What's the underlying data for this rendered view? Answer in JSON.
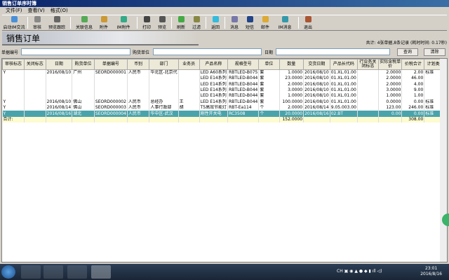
{
  "window": {
    "title": "销售订单序时簿"
  },
  "menu": [
    "文件(F)",
    "查看(V)",
    "格式(O)"
  ],
  "toolbar": [
    "启动IM交流",
    "审核",
    "预览跟踪",
    "关联信息",
    "附件",
    "IM附件",
    "打印",
    "预览",
    "刷新",
    "过滤",
    "返回",
    "消息",
    "短信",
    "邮件",
    "IM消息",
    "退出"
  ],
  "banner": {
    "title": "销售订单"
  },
  "summary": "共计: 4张单据,8条记录 (耗时时间: 0.17秒)",
  "filter": {
    "bill_no_label": "单据编号",
    "bill_no_value": "",
    "customer_label": "购货单位",
    "customer_value": "",
    "date_label": "日期",
    "date_value": "",
    "search": "查询",
    "clear": "清除"
  },
  "table": {
    "columns": [
      "审核标志",
      "关闭标志",
      "日期",
      "购货单位",
      "单据编号",
      "币别",
      "部门",
      "业务员",
      "产品名称",
      "规格型号",
      "单位",
      "数量",
      "交货日期",
      "产品长代码",
      "行业务关闭标志",
      "实际含税单价",
      "价税合计",
      "计划类别"
    ],
    "rows": [
      [
        "Y",
        "",
        "2016/08/10",
        "广州",
        "SEORD000001",
        "人民币",
        "华北区-北京代",
        "",
        "LED A60系列",
        "RBTLED-B075",
        "套",
        "1.0000",
        "2016/08/10",
        "01.XL.01.00",
        "",
        "2.0000",
        "2.00",
        "标准"
      ],
      [
        "",
        "",
        "",
        "",
        "",
        "",
        "",
        "",
        "LED E14系列",
        "RBTLED-B044",
        "套",
        "23.0000",
        "2016/08/10",
        "01.XL.01.00",
        "",
        "2.0000",
        "46.00",
        ""
      ],
      [
        "",
        "",
        "",
        "",
        "",
        "",
        "",
        "",
        "LED E14系列",
        "RBTLED-B044",
        "套",
        "2.0000",
        "2016/08/10",
        "01.XL.01.00",
        "",
        "2.0000",
        "4.00",
        ""
      ],
      [
        "",
        "",
        "",
        "",
        "",
        "",
        "",
        "",
        "LED E14系列",
        "RBTLED-B044",
        "套",
        "3.0000",
        "2016/08/10",
        "01.XL.01.00",
        "",
        "3.0000",
        "9.00",
        ""
      ],
      [
        "",
        "",
        "",
        "",
        "",
        "",
        "",
        "",
        "LED E14系列",
        "RBTLED-B044",
        "套",
        "1.0000",
        "2016/08/10",
        "01.XL.01.00",
        "",
        "1.0000",
        "1.00",
        ""
      ],
      [
        "Y",
        "",
        "2016/08/10",
        "佛山",
        "SEORD000002",
        "人民币",
        "总经办",
        "王",
        "LED E14系列",
        "RBTLED-B044",
        "套",
        "100.0000",
        "2016/08/10",
        "01.XL.01.00",
        "",
        "0.0000",
        "0.00",
        "标准"
      ],
      [
        "Y",
        "",
        "2016/08/14",
        "佛山",
        "SEORD000003",
        "人民币",
        "人事行政部",
        "胡",
        "T5高效节能灯",
        "RBT-Ea114",
        "个",
        "2.0000",
        "2016/08/14",
        "9.05.003.00",
        "",
        "123.00",
        "246.00",
        "标准"
      ],
      [
        "Y",
        "",
        "2016/08/16",
        "湖北",
        "SEORD000004",
        "人民币",
        "华中区-武汉",
        "",
        "刚性开关电",
        "RC3508",
        "个",
        "20.0000",
        "2016/08/16",
        "02.BT",
        "",
        "0.00",
        "0.00",
        "标准"
      ]
    ],
    "total": {
      "label": "合计:",
      "qty": "152.0000",
      "amount": "308.00"
    },
    "selected_row": 7
  },
  "taskbar": {
    "lang": "CH",
    "time": "23:01",
    "date": "2016/8/16"
  }
}
